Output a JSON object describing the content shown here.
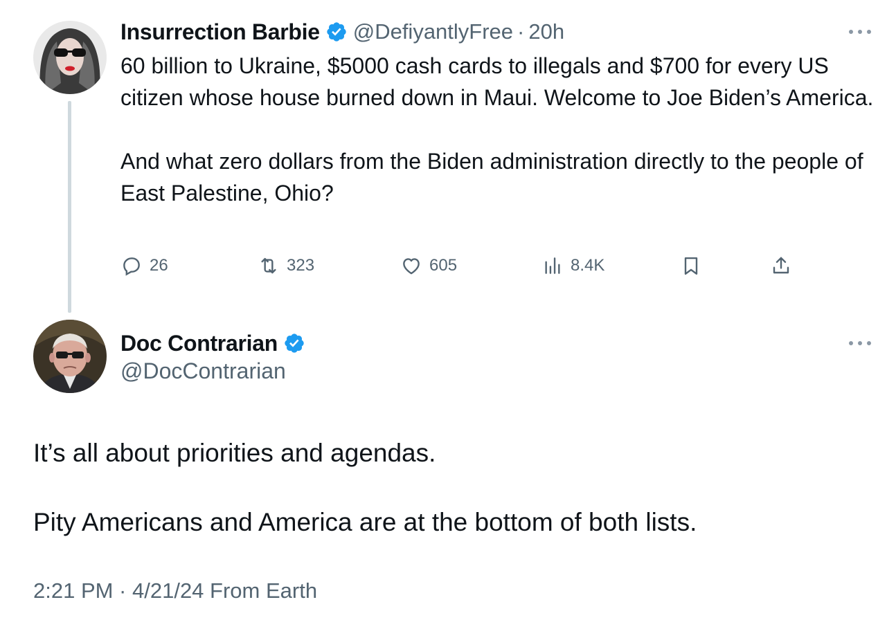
{
  "original_tweet": {
    "display_name": "Insurrection Barbie",
    "handle": "@DefiyantlyFree",
    "separator": "·",
    "time": "20h",
    "paragraphs": [
      "60 billion to Ukraine, $5000 cash cards to illegals and $700 for every US citizen whose house burned down in Maui. Welcome to Joe Biden’s America.",
      "And what zero dollars from the Biden administration directly to the people of East Palestine, Ohio?"
    ],
    "actions": {
      "replies": "26",
      "reposts": "323",
      "likes": "605",
      "views": "8.4K"
    }
  },
  "reply_tweet": {
    "display_name": "Doc Contrarian",
    "handle": "@DocContrarian",
    "paragraphs": [
      "It’s all about priorities and agendas.",
      "Pity Americans and America are at the bottom of both lists."
    ],
    "meta": "2:21 PM · 4/21/24 From Earth"
  },
  "colors": {
    "verified_blue": "#1d9bf0",
    "secondary_text": "#536471",
    "thread_line": "#cfd9de",
    "primary_text": "#0f1419"
  },
  "icons": [
    "verified-badge-icon",
    "more-icon",
    "reply-icon",
    "repost-icon",
    "like-icon",
    "views-icon",
    "bookmark-icon",
    "share-icon"
  ]
}
